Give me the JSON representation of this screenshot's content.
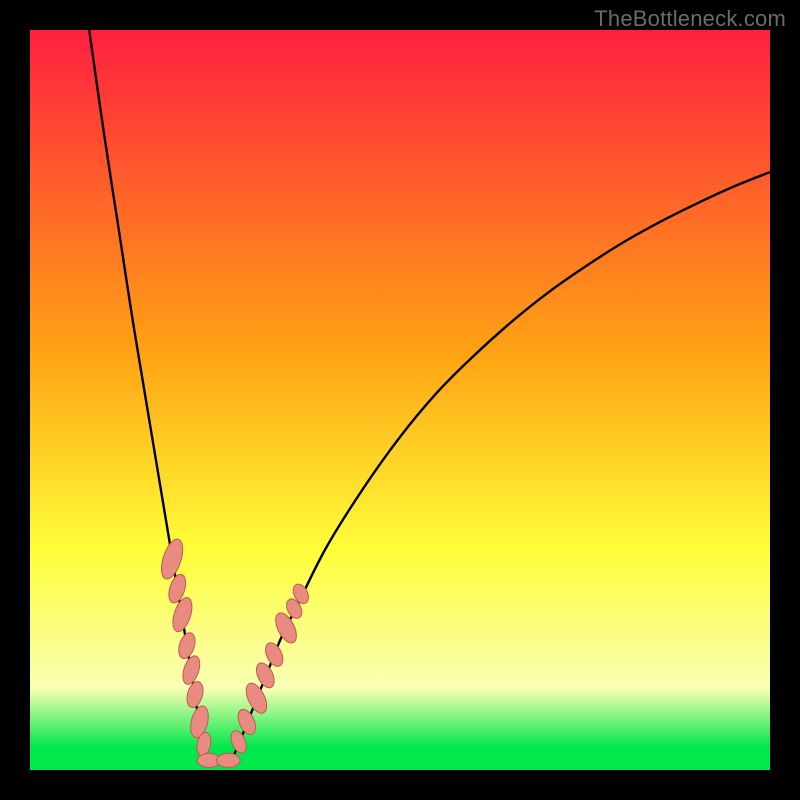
{
  "watermark": {
    "text": "TheBottleneck.com"
  },
  "colors": {
    "red": "#ff1f3f",
    "orange": "#ffa414",
    "yellow": "#fffd38",
    "pale": "#f8ffb4",
    "green": "#00e84a",
    "curve": "#000000",
    "marker_fill": "#e98b80",
    "marker_stroke": "#be5b4f",
    "frame_bg": "#000000"
  },
  "chart_data": {
    "type": "line",
    "title": "",
    "xlabel": "",
    "ylabel": "",
    "xlim": [
      0,
      100
    ],
    "ylim": [
      0,
      100
    ],
    "gradient_bands": [
      {
        "y_top": 100,
        "color_key": "red"
      },
      {
        "y_top": 56,
        "color_key": "orange"
      },
      {
        "y_top": 30,
        "color_key": "yellow"
      },
      {
        "y_top": 11,
        "color_key": "pale"
      },
      {
        "y_top": 3,
        "color_key": "green"
      },
      {
        "y_top": 0,
        "color_key": "green"
      }
    ],
    "series": [
      {
        "name": "left-branch",
        "x": [
          8,
          10,
          12,
          14,
          16,
          17,
          18,
          19,
          20,
          21,
          22,
          22.6,
          23.2,
          23.8,
          24.3
        ],
        "y": [
          100,
          86,
          73,
          60,
          48,
          42,
          36,
          30,
          24,
          18,
          12,
          8,
          5,
          2.5,
          1
        ]
      },
      {
        "name": "right-branch",
        "x": [
          27.0,
          28,
          30,
          32,
          34,
          36,
          40,
          45,
          50,
          55,
          60,
          65,
          70,
          75,
          80,
          85,
          90,
          95,
          100
        ],
        "y": [
          1,
          3,
          8,
          13,
          18,
          22,
          30,
          38,
          45,
          51,
          56,
          60.5,
          64.5,
          68,
          71.2,
          74,
          76.5,
          78.8,
          80.8
        ]
      }
    ],
    "valley_floor": {
      "x_start": 24.3,
      "x_end": 27.0,
      "y": 1
    },
    "markers": [
      {
        "branch": "left",
        "cx": 19.2,
        "cy": 28.5,
        "rx": 1.2,
        "ry": 2.8,
        "rot": 18
      },
      {
        "branch": "left",
        "cx": 19.9,
        "cy": 24.5,
        "rx": 1.0,
        "ry": 2.0,
        "rot": 18
      },
      {
        "branch": "left",
        "cx": 20.6,
        "cy": 21.0,
        "rx": 1.1,
        "ry": 2.4,
        "rot": 18
      },
      {
        "branch": "left",
        "cx": 21.2,
        "cy": 16.8,
        "rx": 1.0,
        "ry": 1.8,
        "rot": 18
      },
      {
        "branch": "left",
        "cx": 21.8,
        "cy": 13.5,
        "rx": 1.0,
        "ry": 2.0,
        "rot": 18
      },
      {
        "branch": "left",
        "cx": 22.3,
        "cy": 10.2,
        "rx": 1.0,
        "ry": 1.8,
        "rot": 16
      },
      {
        "branch": "left",
        "cx": 22.9,
        "cy": 6.5,
        "rx": 1.1,
        "ry": 2.2,
        "rot": 14
      },
      {
        "branch": "left",
        "cx": 23.5,
        "cy": 3.5,
        "rx": 0.9,
        "ry": 1.6,
        "rot": 12
      },
      {
        "branch": "floor",
        "cx": 24.2,
        "cy": 1.3,
        "rx": 1.6,
        "ry": 0.95,
        "rot": 0
      },
      {
        "branch": "floor",
        "cx": 26.8,
        "cy": 1.3,
        "rx": 1.6,
        "ry": 0.95,
        "rot": 0
      },
      {
        "branch": "right",
        "cx": 28.2,
        "cy": 3.8,
        "rx": 0.9,
        "ry": 1.6,
        "rot": -22
      },
      {
        "branch": "right",
        "cx": 29.3,
        "cy": 6.5,
        "rx": 1.0,
        "ry": 1.8,
        "rot": -24
      },
      {
        "branch": "right",
        "cx": 30.6,
        "cy": 9.7,
        "rx": 1.1,
        "ry": 2.2,
        "rot": -26
      },
      {
        "branch": "right",
        "cx": 31.8,
        "cy": 12.8,
        "rx": 1.0,
        "ry": 1.8,
        "rot": -26
      },
      {
        "branch": "right",
        "cx": 33.0,
        "cy": 15.6,
        "rx": 1.0,
        "ry": 1.7,
        "rot": -26
      },
      {
        "branch": "right",
        "cx": 34.6,
        "cy": 19.2,
        "rx": 1.1,
        "ry": 2.2,
        "rot": -27
      },
      {
        "branch": "right",
        "cx": 35.7,
        "cy": 21.8,
        "rx": 0.9,
        "ry": 1.4,
        "rot": -27
      },
      {
        "branch": "right",
        "cx": 36.6,
        "cy": 23.8,
        "rx": 0.9,
        "ry": 1.4,
        "rot": -27
      }
    ]
  }
}
